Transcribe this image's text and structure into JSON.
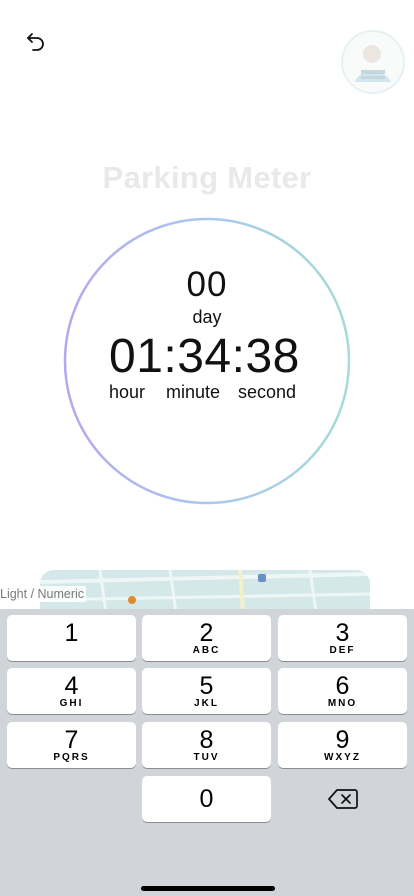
{
  "header": {
    "back_icon": "undo-arrow-icon",
    "avatar_icon": "user-avatar-icon"
  },
  "page_title": "Parking Meter",
  "timer": {
    "day_value": "00",
    "day_label": "day",
    "time_value": "01:34:38",
    "hour_label": "hour",
    "minute_label": "minute",
    "second_label": "second",
    "ring_colors": {
      "start": "#b6a7ee",
      "mid": "#a9c8f0",
      "end": "#a6dbd6"
    }
  },
  "map_overlay_label": "Light / Numeric",
  "keyboard": {
    "keys": [
      {
        "num": "1",
        "letters": ""
      },
      {
        "num": "2",
        "letters": "ABC"
      },
      {
        "num": "3",
        "letters": "DEF"
      },
      {
        "num": "4",
        "letters": "GHI"
      },
      {
        "num": "5",
        "letters": "JKL"
      },
      {
        "num": "6",
        "letters": "MNO"
      },
      {
        "num": "7",
        "letters": "PQRS"
      },
      {
        "num": "8",
        "letters": "TUV"
      },
      {
        "num": "9",
        "letters": "WXYZ"
      },
      {
        "num": "0",
        "letters": ""
      }
    ],
    "delete_icon": "backspace-icon"
  }
}
